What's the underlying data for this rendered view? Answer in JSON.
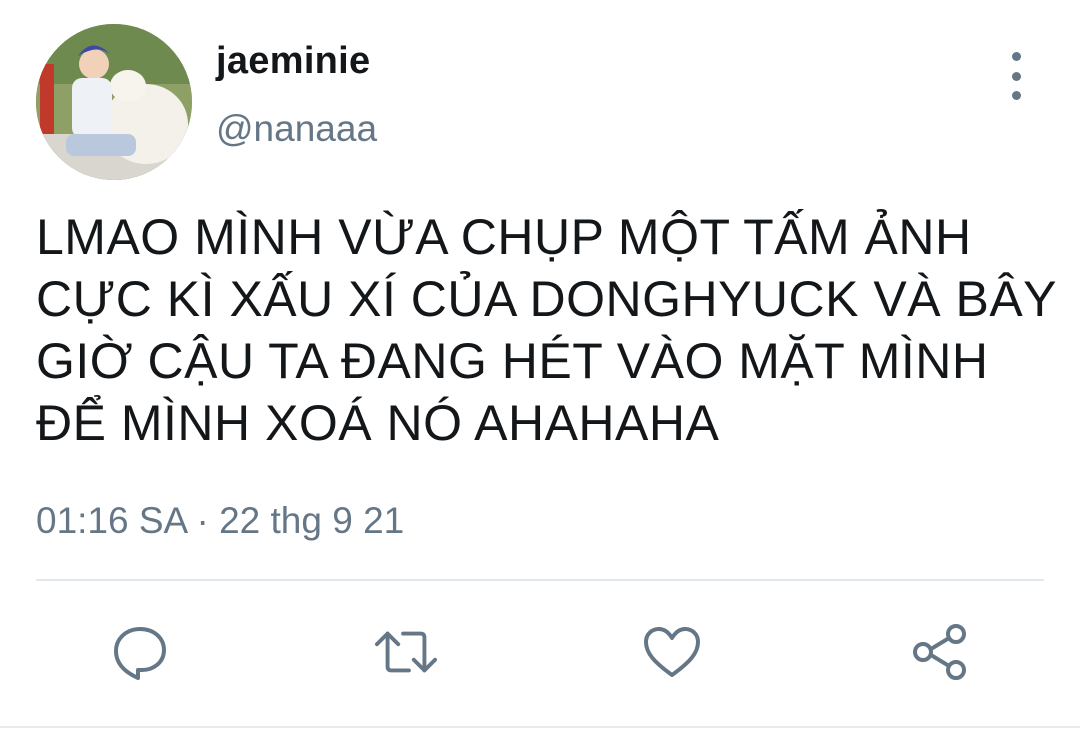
{
  "user": {
    "display_name": "jaeminie",
    "handle": "@nanaaa",
    "avatar_icon": "profile-photo"
  },
  "tweet": {
    "lines": [
      "LMAO MÌNH VỪA CHỤP MỘT TẤM ẢNH",
      "CỰC KÌ XẤU XÍ CỦA DONGHYUCK VÀ BÂY",
      "GIỜ CẬU TA ĐANG HÉT VÀO MẶT MÌNH",
      "ĐỂ MÌNH XOÁ NÓ AHAHAHA"
    ],
    "time": "01:16 SA",
    "separator": "·",
    "date": "22 thg 9 21"
  },
  "actions": {
    "reply_icon": "reply-icon",
    "retweet_icon": "retweet-icon",
    "like_icon": "like-icon",
    "share_icon": "share-icon"
  },
  "colors": {
    "text_primary": "#14171a",
    "text_secondary": "#657786",
    "divider": "#e1e8ed"
  }
}
